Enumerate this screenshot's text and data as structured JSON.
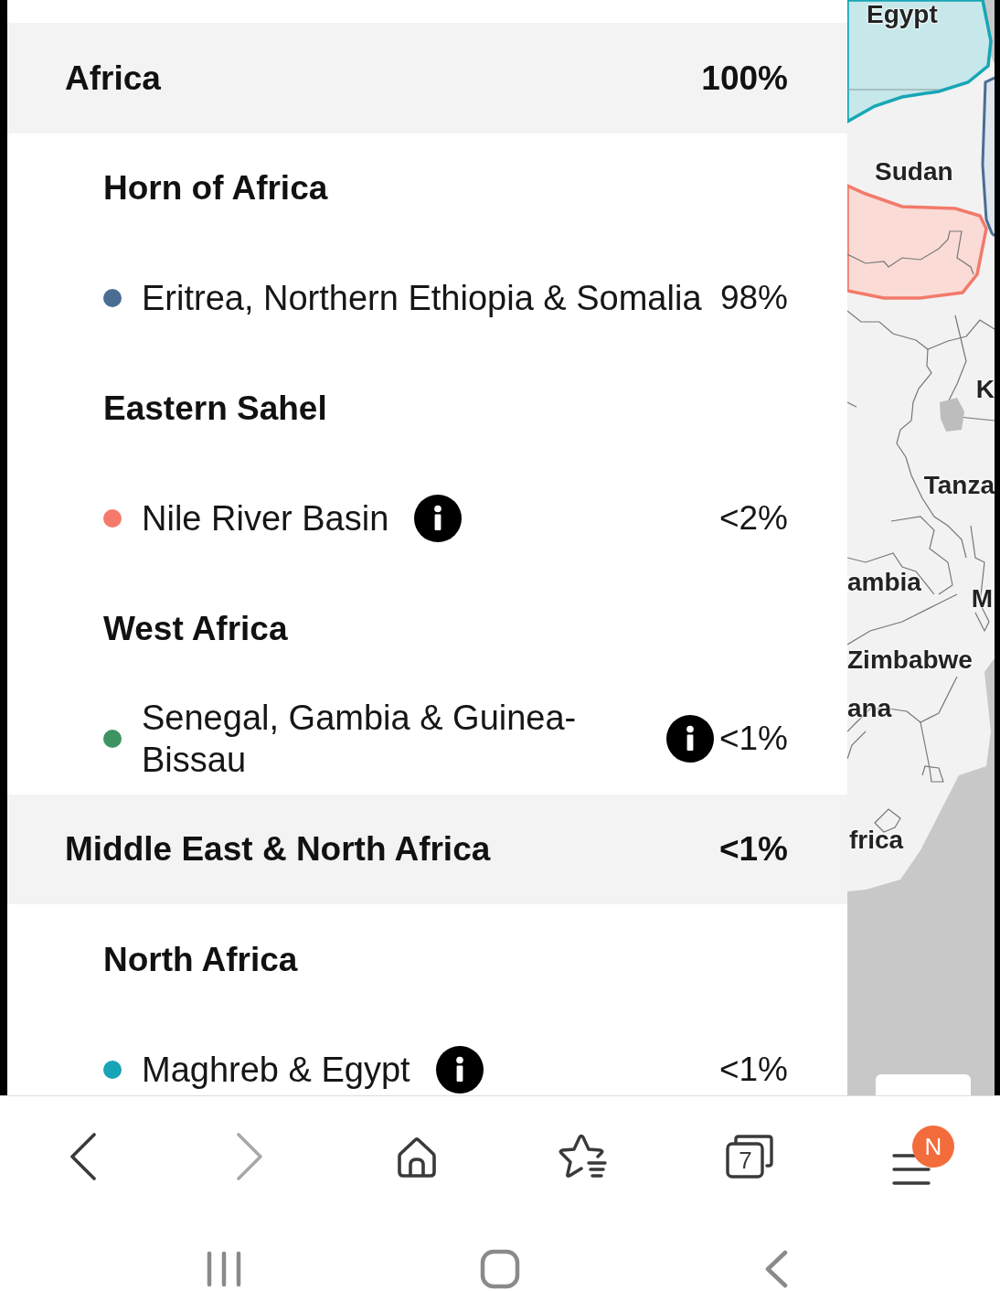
{
  "regions": [
    {
      "name": "Africa",
      "percent": "100%",
      "subregions": [
        {
          "name": "Horn of Africa",
          "populations": [
            {
              "name": "Eritrea, Northern Ethiopia & Somalia",
              "percent": "98%",
              "color": "#4a6d94",
              "info": false
            }
          ]
        },
        {
          "name": "Eastern Sahel",
          "populations": [
            {
              "name": "Nile River Basin",
              "percent": "<2%",
              "color": "#f57a6b",
              "info": true
            }
          ]
        },
        {
          "name": "West Africa",
          "populations": [
            {
              "name": "Senegal, Gambia & Guinea-Bissau",
              "percent": "<1%",
              "color": "#3e9461",
              "info": true
            }
          ]
        }
      ]
    },
    {
      "name": "Middle East & North Africa",
      "percent": "<1%",
      "subregions": [
        {
          "name": "North Africa",
          "populations": [
            {
              "name": "Maghreb & Egypt",
              "percent": "<1%",
              "color": "#17a4b6",
              "info": true
            }
          ]
        }
      ]
    }
  ],
  "map": {
    "labels": [
      "Egypt",
      "Sudan",
      "K",
      "Tanza",
      "ambia",
      "M",
      "Zimbabwe",
      "ana",
      "frica"
    ]
  },
  "toolbar": [
    {
      "kind": "back",
      "disabled": false
    },
    {
      "kind": "forward",
      "disabled": true
    },
    {
      "kind": "home",
      "disabled": false
    },
    {
      "kind": "bookmarks",
      "disabled": false
    },
    {
      "kind": "tabs",
      "disabled": false,
      "count": "7"
    },
    {
      "kind": "menu",
      "disabled": false,
      "badge": "N"
    }
  ],
  "system_nav": [
    {
      "kind": "recents"
    },
    {
      "kind": "home"
    },
    {
      "kind": "back"
    }
  ]
}
